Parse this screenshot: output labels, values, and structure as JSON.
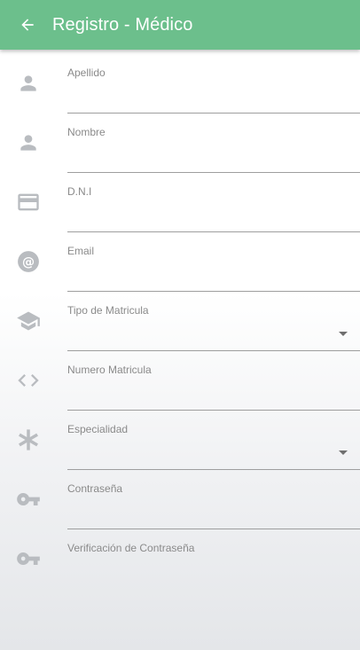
{
  "appbar": {
    "title": "Registro - Médico",
    "back_icon": "arrow-left-icon",
    "color": "#6cbf8c"
  },
  "form": {
    "fields": [
      {
        "label": "Apellido",
        "value": "",
        "icon": "person-icon",
        "type": "text"
      },
      {
        "label": "Nombre",
        "value": "",
        "icon": "person-icon",
        "type": "text"
      },
      {
        "label": "D.N.I",
        "value": "",
        "icon": "card-icon",
        "type": "text"
      },
      {
        "label": "Email",
        "value": "",
        "icon": "at-icon",
        "type": "text"
      },
      {
        "label": "Tipo de Matricula",
        "value": "",
        "icon": "school-icon",
        "type": "select"
      },
      {
        "label": "Numero Matricula",
        "value": "",
        "icon": "code-icon",
        "type": "text"
      },
      {
        "label": "Especialidad",
        "value": "",
        "icon": "asterisk-icon",
        "type": "select"
      },
      {
        "label": "Contraseña",
        "value": "",
        "icon": "key-icon",
        "type": "password"
      },
      {
        "label": "Verificación de Contraseña",
        "value": "",
        "icon": "key-icon",
        "type": "password"
      }
    ]
  }
}
